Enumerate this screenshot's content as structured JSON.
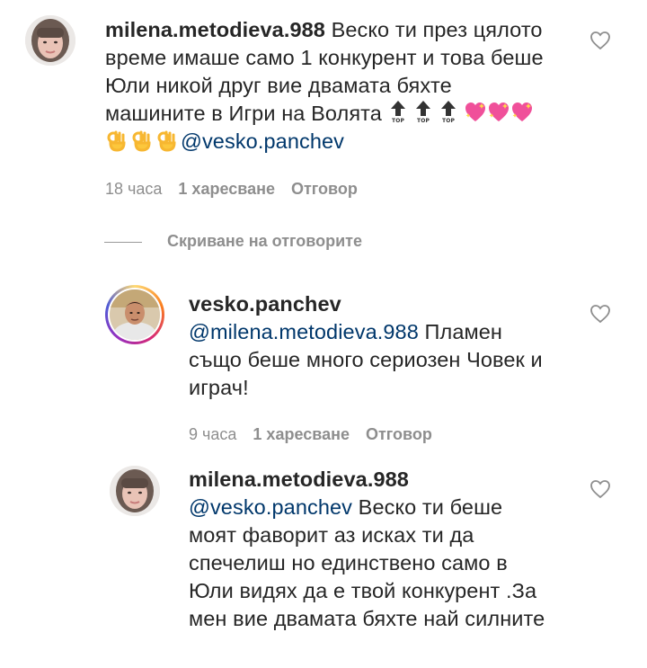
{
  "comments": [
    {
      "username": "milena.metodieva.988",
      "lines": [
        "Веско ти през цялото",
        "време имаше само 1 конкурент и това беше",
        "Юли никой друг вие двамата бяхте",
        "машините в Игри на Волята"
      ],
      "emoji_line": [
        "top-arrow-emoji",
        "top-arrow-emoji",
        "top-arrow-emoji",
        "sparkling-heart-emoji",
        "sparkling-heart-emoji",
        "sparkling-heart-emoji"
      ],
      "ok_emojis": [
        "ok-hand-emoji",
        "ok-hand-emoji",
        "ok-hand-emoji"
      ],
      "mention": "@vesko.panchev",
      "time": "18 часа",
      "likes": "1 харесване",
      "reply": "Отговор"
    },
    {
      "username": "vesko.panchev",
      "mention": "@milena.metodieva.988",
      "lines": [
        "Пламен",
        "също беше много сериозен Човек и",
        "играч!"
      ],
      "time": "9 часа",
      "likes": "1 харесване",
      "reply": "Отговор"
    },
    {
      "username": "milena.metodieva.988",
      "mention": "@vesko.panchev",
      "lines": [
        "Веско ти беше",
        "моят фаворит аз исках ти да",
        "спечелиш но единствено само в",
        "Юли видях да е твой конкурент .За",
        "мен вие двамата бяхте най силните"
      ]
    }
  ],
  "hide_replies": "Скриване на отговорите",
  "colors": {
    "text": "#262626",
    "meta": "#8e8e8e",
    "mention": "#00376b"
  }
}
